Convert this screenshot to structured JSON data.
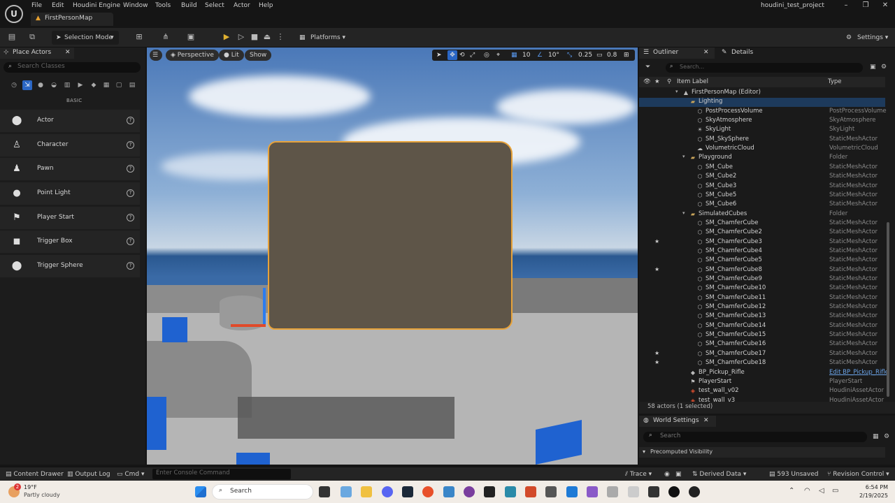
{
  "menu": [
    "File",
    "Edit",
    "Houdini Engine",
    "Window",
    "Tools",
    "Build",
    "Select",
    "Actor",
    "Help"
  ],
  "map_tab": "FirstPersonMap",
  "project_name": "houdini_test_project",
  "toolbar": {
    "mode": "Selection Mode",
    "platforms": "Platforms",
    "settings": "Settings"
  },
  "place_actors": {
    "tab": "Place Actors",
    "search_placeholder": "Search Classes",
    "category": "BASIC",
    "actors": [
      "Actor",
      "Character",
      "Pawn",
      "Point Light",
      "Player Start",
      "Trigger Box",
      "Trigger Sphere"
    ]
  },
  "viewport": {
    "perspective": "Perspective",
    "lit": "Lit",
    "show": "Show",
    "grid": "10",
    "angle": "10°",
    "scale": "0.25",
    "cam_speed": "0.8"
  },
  "outliner": {
    "tab": "Outliner",
    "details_tab": "Details",
    "search_placeholder": "Search...",
    "col_label": "Item Label",
    "col_type": "Type",
    "rows": [
      {
        "label": "FirstPersonMap (Editor)",
        "type": "",
        "indent": 0,
        "icon": "map",
        "star": false,
        "expand": true
      },
      {
        "label": "Lighting",
        "type": "",
        "indent": 1,
        "icon": "folder",
        "star": false,
        "expand": false,
        "selected": true
      },
      {
        "label": "PostProcessVolume",
        "type": "PostProcessVolume",
        "indent": 2,
        "icon": "mesh",
        "star": false
      },
      {
        "label": "SkyAtmosphere",
        "type": "SkyAtmosphere",
        "indent": 2,
        "icon": "mesh",
        "star": false
      },
      {
        "label": "SkyLight",
        "type": "SkyLight",
        "indent": 2,
        "icon": "light",
        "star": false
      },
      {
        "label": "SM_SkySphere",
        "type": "StaticMeshActor",
        "indent": 2,
        "icon": "mesh",
        "star": false
      },
      {
        "label": "VolumetricCloud",
        "type": "VolumetricCloud",
        "indent": 2,
        "icon": "cloud",
        "star": false
      },
      {
        "label": "Playground",
        "type": "Folder",
        "indent": 1,
        "icon": "folder",
        "star": false,
        "expand": true
      },
      {
        "label": "SM_Cube",
        "type": "StaticMeshActor",
        "indent": 2,
        "icon": "mesh",
        "star": false
      },
      {
        "label": "SM_Cube2",
        "type": "StaticMeshActor",
        "indent": 2,
        "icon": "mesh",
        "star": false
      },
      {
        "label": "SM_Cube3",
        "type": "StaticMeshActor",
        "indent": 2,
        "icon": "mesh",
        "star": false
      },
      {
        "label": "SM_Cube5",
        "type": "StaticMeshActor",
        "indent": 2,
        "icon": "mesh",
        "star": false
      },
      {
        "label": "SM_Cube6",
        "type": "StaticMeshActor",
        "indent": 2,
        "icon": "mesh",
        "star": false
      },
      {
        "label": "SimulatedCubes",
        "type": "Folder",
        "indent": 1,
        "icon": "folder",
        "star": false,
        "expand": true
      },
      {
        "label": "SM_ChamferCube",
        "type": "StaticMeshActor",
        "indent": 2,
        "icon": "mesh",
        "star": false
      },
      {
        "label": "SM_ChamferCube2",
        "type": "StaticMeshActor",
        "indent": 2,
        "icon": "mesh",
        "star": false
      },
      {
        "label": "SM_ChamferCube3",
        "type": "StaticMeshActor",
        "indent": 2,
        "icon": "mesh",
        "star": true
      },
      {
        "label": "SM_ChamferCube4",
        "type": "StaticMeshActor",
        "indent": 2,
        "icon": "mesh",
        "star": false
      },
      {
        "label": "SM_ChamferCube5",
        "type": "StaticMeshActor",
        "indent": 2,
        "icon": "mesh",
        "star": false
      },
      {
        "label": "SM_ChamferCube8",
        "type": "StaticMeshActor",
        "indent": 2,
        "icon": "mesh",
        "star": true
      },
      {
        "label": "SM_ChamferCube9",
        "type": "StaticMeshActor",
        "indent": 2,
        "icon": "mesh",
        "star": false
      },
      {
        "label": "SM_ChamferCube10",
        "type": "StaticMeshActor",
        "indent": 2,
        "icon": "mesh",
        "star": false
      },
      {
        "label": "SM_ChamferCube11",
        "type": "StaticMeshActor",
        "indent": 2,
        "icon": "mesh",
        "star": false
      },
      {
        "label": "SM_ChamferCube12",
        "type": "StaticMeshActor",
        "indent": 2,
        "icon": "mesh",
        "star": false
      },
      {
        "label": "SM_ChamferCube13",
        "type": "StaticMeshActor",
        "indent": 2,
        "icon": "mesh",
        "star": false
      },
      {
        "label": "SM_ChamferCube14",
        "type": "StaticMeshActor",
        "indent": 2,
        "icon": "mesh",
        "star": false
      },
      {
        "label": "SM_ChamferCube15",
        "type": "StaticMeshActor",
        "indent": 2,
        "icon": "mesh",
        "star": false
      },
      {
        "label": "SM_ChamferCube16",
        "type": "StaticMeshActor",
        "indent": 2,
        "icon": "mesh",
        "star": false
      },
      {
        "label": "SM_ChamferCube17",
        "type": "StaticMeshActor",
        "indent": 2,
        "icon": "mesh",
        "star": true
      },
      {
        "label": "SM_ChamferCube18",
        "type": "StaticMeshActor",
        "indent": 2,
        "icon": "mesh",
        "star": true
      },
      {
        "label": "BP_Pickup_Rifle",
        "type": "Edit BP_Pickup_Rifle",
        "indent": 1,
        "icon": "bp",
        "star": false,
        "link": true
      },
      {
        "label": "PlayerStart",
        "type": "PlayerStart",
        "indent": 1,
        "icon": "player",
        "star": false
      },
      {
        "label": "test_wall_v02",
        "type": "HoudiniAssetActor",
        "indent": 1,
        "icon": "houdini",
        "star": false
      },
      {
        "label": "test_wall_v3",
        "type": "HoudiniAssetActor",
        "indent": 1,
        "icon": "houdini",
        "star": false
      }
    ],
    "footer": "58 actors (1 selected)"
  },
  "world_settings": {
    "tab": "World Settings",
    "search_placeholder": "Search",
    "section": "Precomputed Visibility"
  },
  "statusbar": {
    "content_drawer": "Content Drawer",
    "output_log": "Output Log",
    "cmd": "Cmd",
    "console_placeholder": "Enter Console Command",
    "trace": "Trace",
    "derived_data": "Derived Data",
    "unsaved": "593 Unsaved",
    "revision_control": "Revision Control"
  },
  "taskbar": {
    "temp": "19°F",
    "weather": "Partly cloudy",
    "badge": "2",
    "search": "Search",
    "time": "6:54 PM",
    "date": "2/19/2025"
  }
}
